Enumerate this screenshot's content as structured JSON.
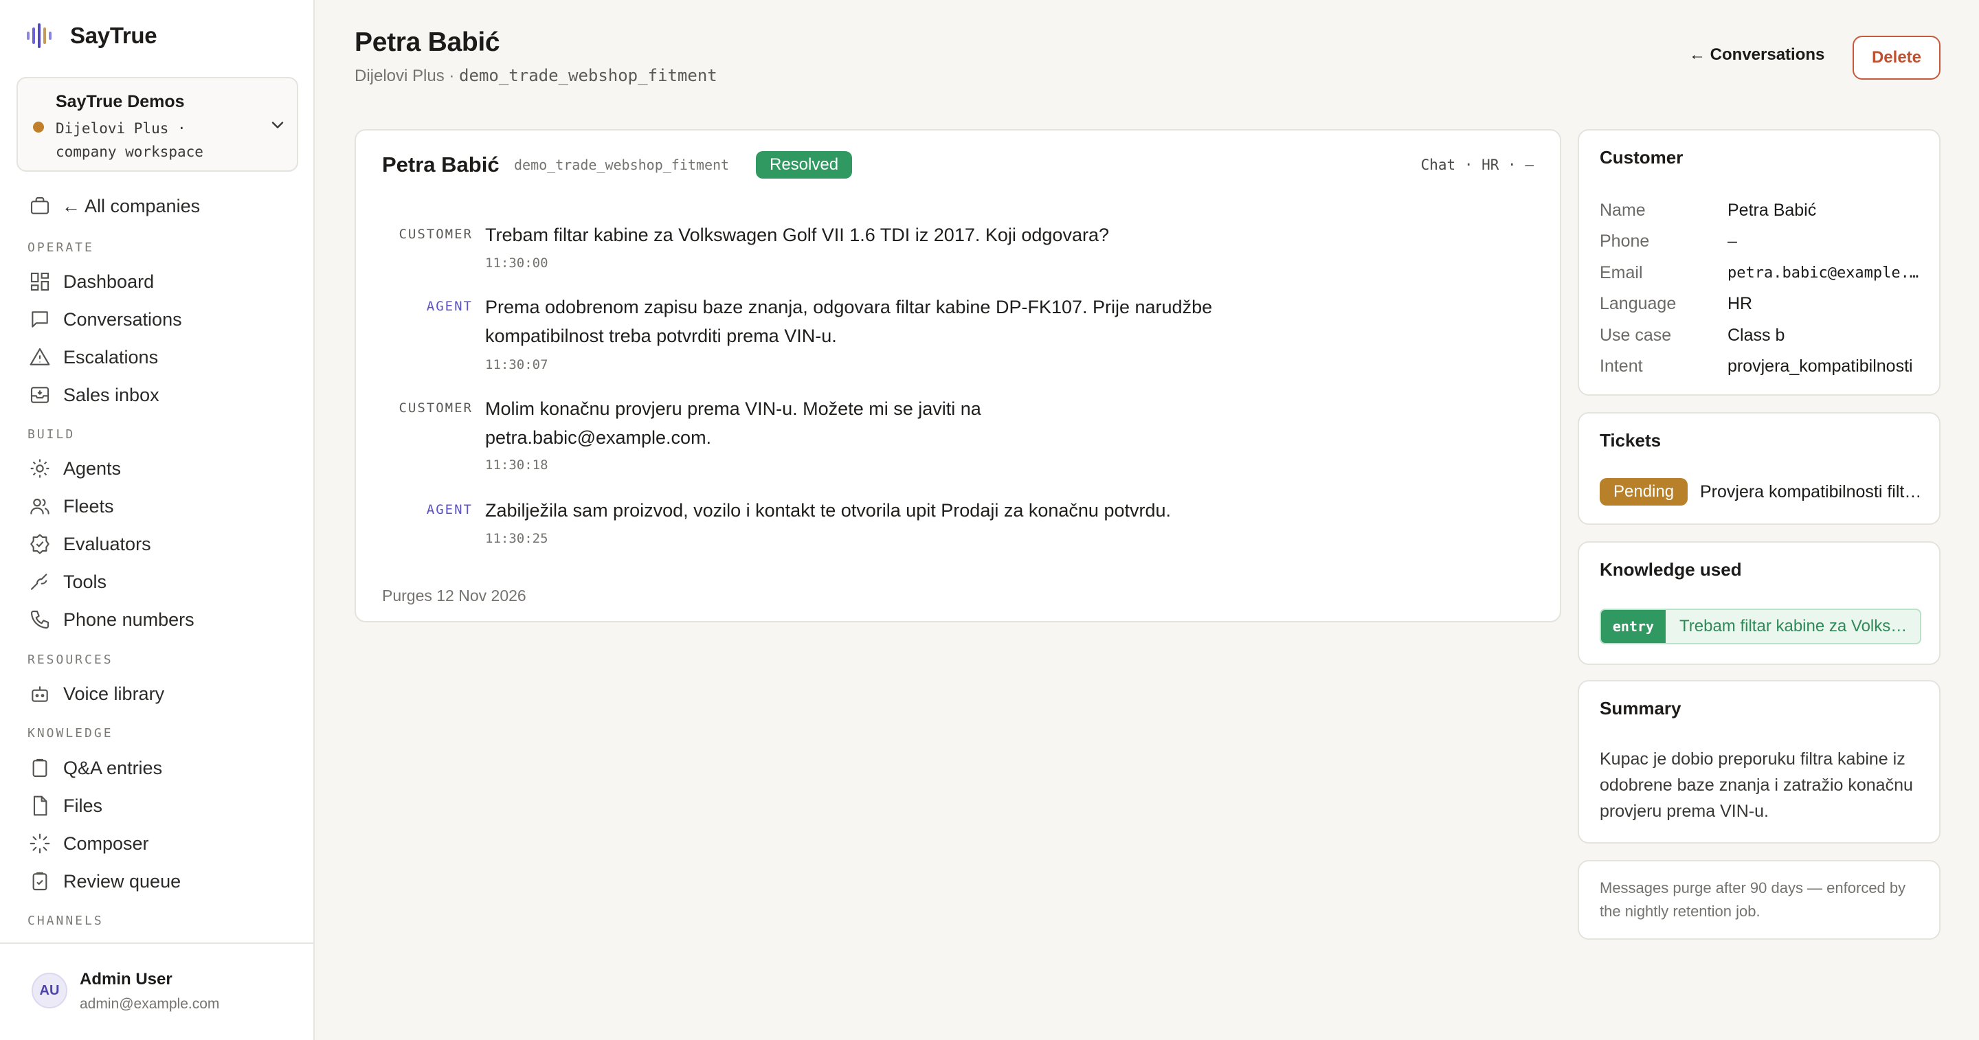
{
  "app": {
    "name": "SayTrue"
  },
  "workspace": {
    "title": "SayTrue Demos",
    "subtitle": "Dijelovi Plus · company workspace",
    "status_color": "#c0802a"
  },
  "sidebar": {
    "all_companies": "← All companies",
    "sections": {
      "operate": "OPERATE",
      "build": "BUILD",
      "resources": "RESOURCES",
      "knowledge": "KNOWLEDGE",
      "channels": "CHANNELS"
    },
    "items": {
      "dashboard": "Dashboard",
      "conversations": "Conversations",
      "escalations": "Escalations",
      "sales_inbox": "Sales inbox",
      "agents": "Agents",
      "fleets": "Fleets",
      "evaluators": "Evaluators",
      "tools": "Tools",
      "phone_numbers": "Phone numbers",
      "voice_library": "Voice library",
      "qa_entries": "Q&A entries",
      "files": "Files",
      "composer": "Composer",
      "review_queue": "Review queue"
    }
  },
  "user": {
    "initials": "AU",
    "name": "Admin User",
    "email": "admin@example.com"
  },
  "header": {
    "title": "Petra Babić",
    "company": "Dijelovi Plus ·",
    "code": "demo_trade_webshop_fitment",
    "back_label": "← Conversations",
    "delete_label": "Delete"
  },
  "conversation": {
    "name": "Petra Babić",
    "code": "demo_trade_webshop_fitment",
    "status": "Resolved",
    "meta": "Chat · HR · –",
    "messages": [
      {
        "role": "CUSTOMER",
        "text": "Trebam filtar kabine za Volkswagen Golf VII 1.6 TDI iz 2017. Koji odgovara?",
        "time": "11:30:00"
      },
      {
        "role": "AGENT",
        "text": "Prema odobrenom zapisu baze znanja, odgovara filtar kabine DP-FK107. Prije narudžbe kompatibilnost treba potvrditi prema VIN-u.",
        "time": "11:30:07"
      },
      {
        "role": "CUSTOMER",
        "text": "Molim konačnu provjeru prema VIN-u. Možete mi se javiti na petra.babic@example.com.",
        "time": "11:30:18"
      },
      {
        "role": "AGENT",
        "text": "Zabilježila sam proizvod, vozilo i kontakt te otvorila upit Prodaji za konačnu potvrdu.",
        "time": "11:30:25"
      }
    ],
    "purges": "Purges 12 Nov 2026"
  },
  "customer": {
    "title": "Customer",
    "fields": [
      {
        "label": "Name",
        "value": "Petra Babić"
      },
      {
        "label": "Phone",
        "value": "–"
      },
      {
        "label": "Email",
        "value": "petra.babic@example.com"
      },
      {
        "label": "Language",
        "value": "HR"
      },
      {
        "label": "Use case",
        "value": "Class b"
      },
      {
        "label": "Intent",
        "value": "provjera_kompatibilnosti"
      }
    ]
  },
  "tickets": {
    "title": "Tickets",
    "status": "Pending",
    "text": "Provjera kompatibilnosti filtra kabine"
  },
  "knowledge": {
    "title": "Knowledge used",
    "tag": "entry",
    "text": "Trebam filtar kabine za Volkswagen Golf VII"
  },
  "summary": {
    "title": "Summary",
    "text": "Kupac je dobio preporuku filtra kabine iz odobrene baze znanja i zatražio konačnu provjeru prema VIN-u."
  },
  "retention_note": "Messages purge after 90 days — enforced by the nightly retention job.",
  "colors": {
    "accent": "#5b52c8",
    "resolved": "#2f9961",
    "pending": "#b9802a",
    "delete": "#c0502f"
  }
}
